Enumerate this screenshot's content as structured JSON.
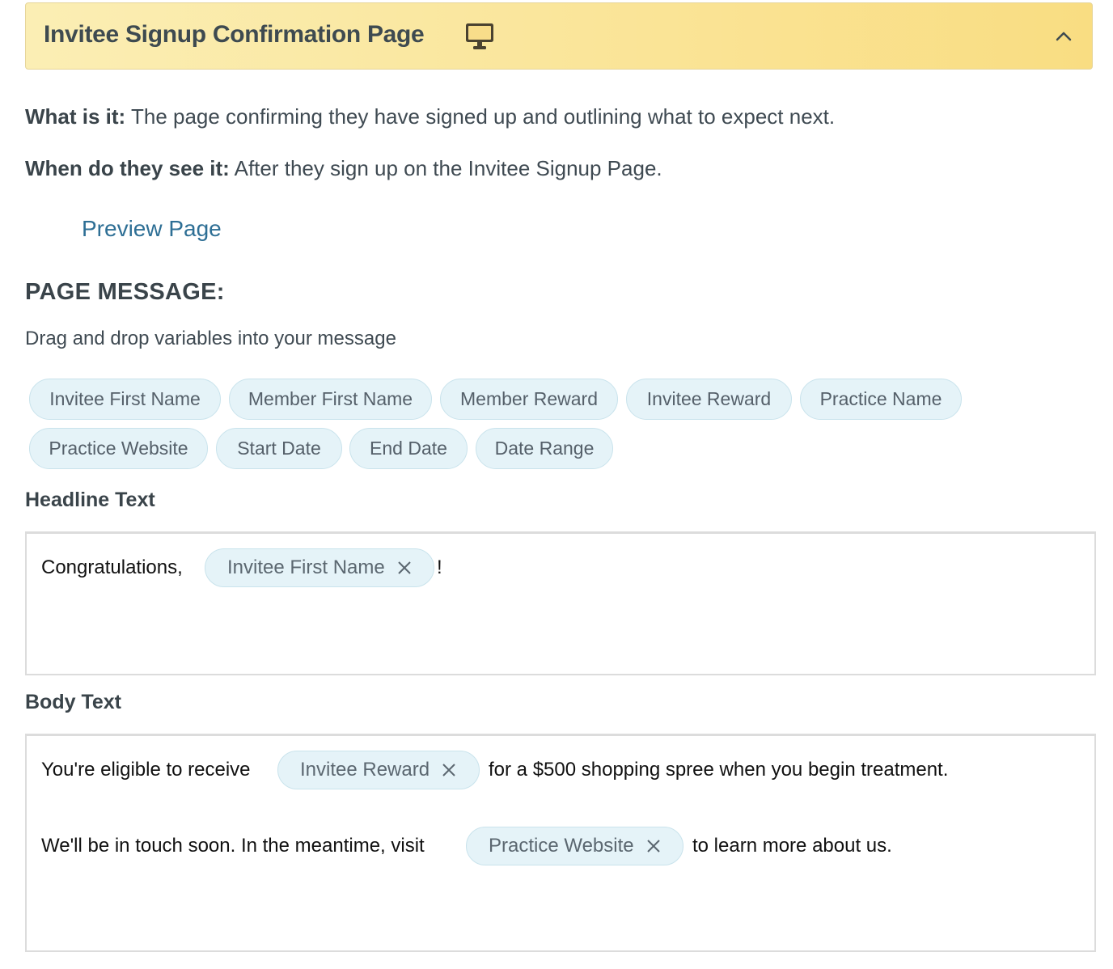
{
  "header": {
    "title": "Invitee Signup Confirmation Page",
    "icons": {
      "device": "monitor-icon",
      "toggle": "chevron-up-icon"
    },
    "colors": {
      "gradient_start": "#fbeeb4",
      "gradient_end": "#f9dd82"
    }
  },
  "info": {
    "what_label": "What is it:",
    "what_text": " The page confirming they have signed up and outlining what to expect next.",
    "when_label": "When do they see it:",
    "when_text": " After they sign up on the Invitee Signup Page."
  },
  "preview_link": "Preview Page",
  "page_message": {
    "heading": "PAGE MESSAGE:",
    "instructions": "Drag and drop variables into your message",
    "variables": [
      "Invitee First Name",
      "Member First Name",
      "Member Reward",
      "Invitee Reward",
      "Practice Name",
      "Practice Website",
      "Start Date",
      "End Date",
      "Date Range"
    ]
  },
  "headline": {
    "label": "Headline Text",
    "before": "Congratulations,",
    "variable": "Invitee First Name",
    "after": "!"
  },
  "body": {
    "label": "Body Text",
    "line1_before": "You're eligible to receive",
    "line1_variable": "Invitee Reward",
    "line1_after": "for a $500 shopping spree when you begin treatment.",
    "line2_before": "We'll be in touch soon. In the meantime, visit",
    "line2_variable": "Practice Website",
    "line2_after": "to learn more about us."
  },
  "colors": {
    "link": "#2e6f95",
    "chip_bg": "#e5f3f8",
    "chip_border": "#c9e3ec"
  }
}
